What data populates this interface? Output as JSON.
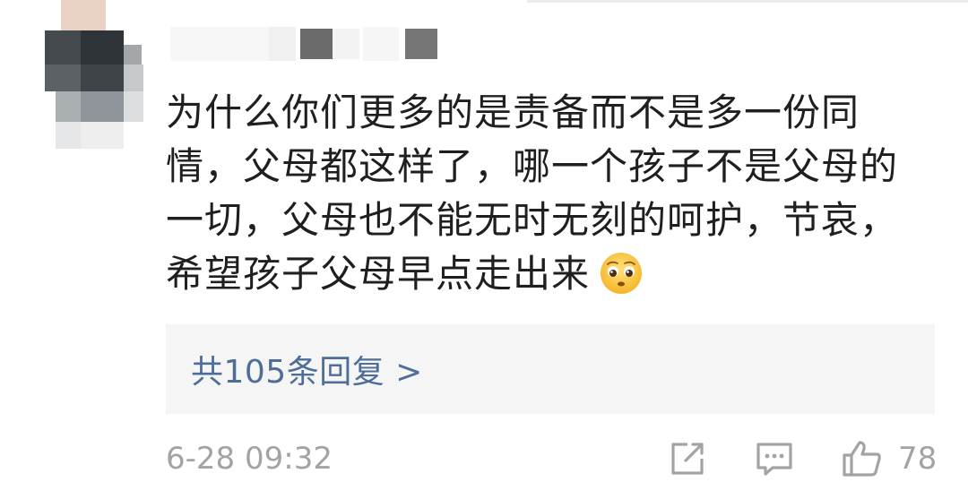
{
  "comment": {
    "lines": [
      "为什么你们更多的是责备而不是多一份同",
      "情，父母都这样了，哪一个孩子不是父母的",
      "一切，父母也不能无时无刻的呵护，节哀，",
      "希望孩子父母早点走出来"
    ],
    "emoji": "pleading-face-emoji"
  },
  "replies": {
    "label": "共105条回复 >"
  },
  "footer": {
    "timestamp": "6-28 09:32",
    "share_icon": "share-icon",
    "reply_icon": "comment-icon",
    "like_icon": "thumbs-up-icon",
    "like_count": "78"
  },
  "colors": {
    "text": "#1f1f1f",
    "link": "#4e6e98",
    "meta": "#a3a3a3",
    "reply_bg": "#f5f5f5"
  }
}
